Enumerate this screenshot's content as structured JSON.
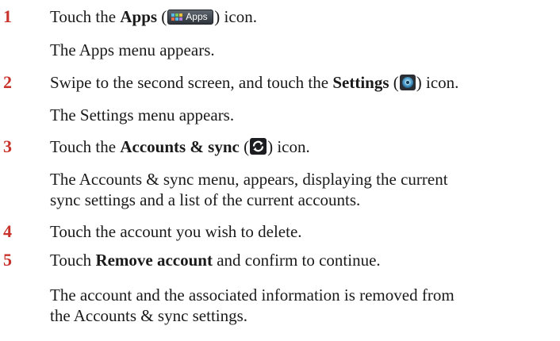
{
  "steps": [
    {
      "number": "1",
      "line_pre": "Touch the ",
      "line_bold": "Apps",
      "line_mid": " (",
      "line_post": ") icon.",
      "icon_label": "Apps",
      "icon": "apps-icon",
      "result": [
        "The Apps menu appears."
      ]
    },
    {
      "number": "2",
      "line_pre": "Swipe to the second screen, and touch the ",
      "line_bold": "Settings",
      "line_mid": " (",
      "line_post": ") icon.",
      "icon": "settings-icon",
      "result": [
        "The Settings menu appears."
      ]
    },
    {
      "number": "3",
      "line_pre": "Touch the ",
      "line_bold": "Accounts & sync",
      "line_mid": " (",
      "line_post": ") icon.",
      "icon": "sync-icon",
      "result": [
        "The Accounts & sync menu, appears, displaying the current",
        "sync settings and a list of the current accounts."
      ]
    },
    {
      "number": "4",
      "line_pre": "Touch the account you wish to delete."
    },
    {
      "number": "5",
      "line_pre": "Touch ",
      "line_bold": "Remove account",
      "line_post": " and confirm to continue.",
      "result": [
        "The account and the associated information is removed from",
        "the Accounts & sync settings."
      ]
    }
  ],
  "colors": {
    "step_number": "#c8322a",
    "text": "#1a1a1a"
  }
}
